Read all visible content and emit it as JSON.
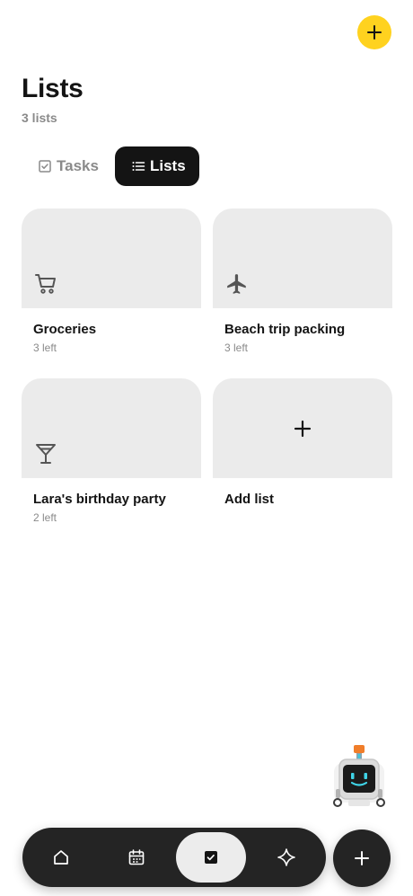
{
  "header": {
    "title": "Lists",
    "subtitle": "3 lists",
    "add_icon": "plus-icon",
    "accent_color": "#ffd21f"
  },
  "tabs": [
    {
      "label": "Tasks",
      "icon": "checkbox-icon",
      "selected": false
    },
    {
      "label": "Lists",
      "icon": "list-icon",
      "selected": true
    }
  ],
  "lists": [
    {
      "name": "Groceries",
      "count": "3 left",
      "icon": "cart-icon"
    },
    {
      "name": "Beach trip packing",
      "count": "3 left",
      "icon": "airplane-icon"
    },
    {
      "name": "Lara's birthday party",
      "count": "2 left",
      "icon": "cocktail-icon"
    }
  ],
  "add_list": {
    "label": "Add list",
    "icon": "plus-icon"
  },
  "assistant": {
    "icon": "robot-icon"
  },
  "bottom_nav": {
    "items": [
      {
        "icon": "home-icon",
        "selected": false
      },
      {
        "icon": "calendar-icon",
        "selected": false
      },
      {
        "icon": "checkbox-icon",
        "selected": true
      },
      {
        "icon": "sparkle-icon",
        "selected": false
      }
    ],
    "fab_icon": "plus-icon"
  }
}
